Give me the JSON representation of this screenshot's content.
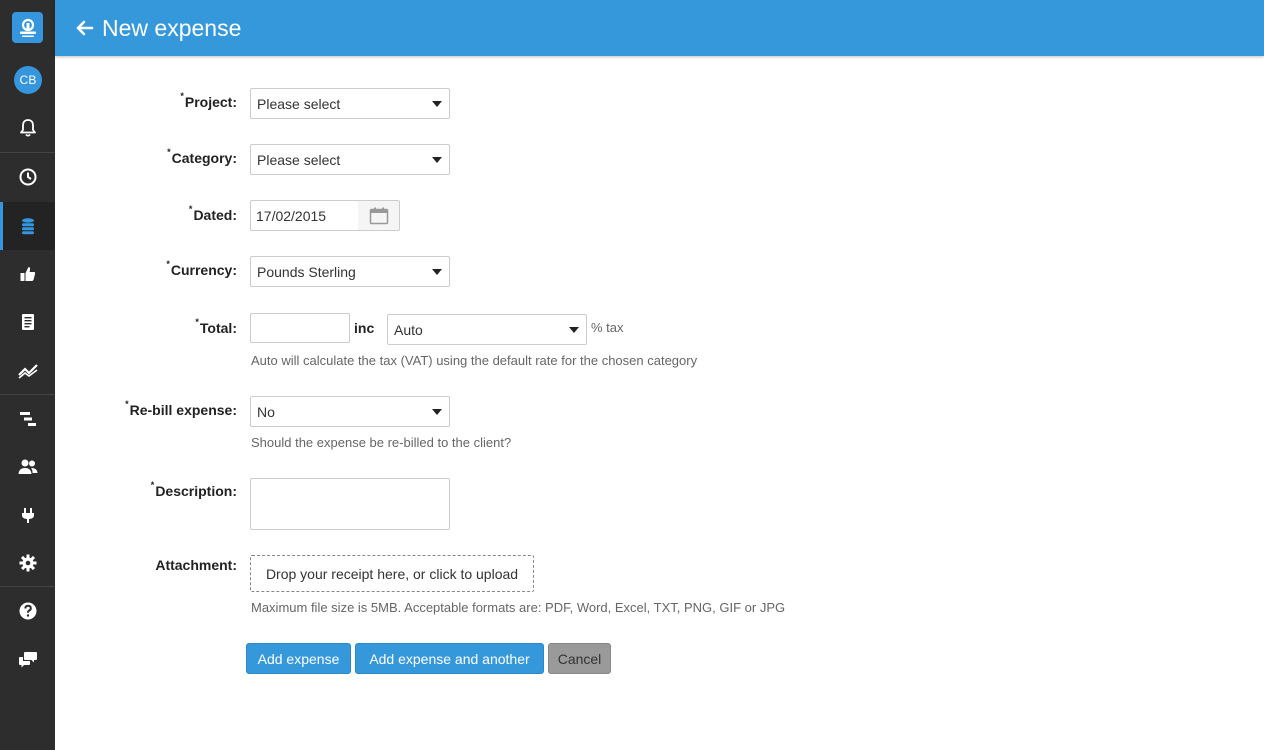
{
  "header": {
    "title": "New expense"
  },
  "sidebar": {
    "avatar_initials": "CB",
    "items": [
      {
        "name": "notifications",
        "icon": "bell-icon"
      },
      {
        "name": "time",
        "icon": "clock-icon"
      },
      {
        "name": "expenses",
        "icon": "coins-icon",
        "active": true
      },
      {
        "name": "approvals",
        "icon": "thumbs-up-icon"
      },
      {
        "name": "invoices",
        "icon": "document-icon"
      },
      {
        "name": "reports",
        "icon": "chart-line-icon"
      },
      {
        "name": "planning",
        "icon": "gantt-icon"
      },
      {
        "name": "people",
        "icon": "users-icon"
      },
      {
        "name": "integrations",
        "icon": "plug-icon"
      },
      {
        "name": "settings",
        "icon": "gear-icon"
      },
      {
        "name": "help",
        "icon": "question-icon"
      },
      {
        "name": "feedback",
        "icon": "chat-icon"
      }
    ]
  },
  "form": {
    "required_mark": "*",
    "project": {
      "label": "Project:",
      "value": "Please select"
    },
    "category": {
      "label": "Category:",
      "value": "Please select"
    },
    "dated": {
      "label": "Dated:",
      "value": "17/02/2015"
    },
    "currency": {
      "label": "Currency:",
      "value": "Pounds Sterling"
    },
    "total": {
      "label": "Total:",
      "value": "",
      "inc_label": "inc",
      "tax_value": "Auto",
      "tax_suffix": "% tax",
      "help": "Auto will calculate the tax (VAT) using the default rate for the chosen category"
    },
    "rebill": {
      "label": "Re-bill expense:",
      "value": "No",
      "help": "Should the expense be re-billed to the client?"
    },
    "description": {
      "label": "Description:",
      "value": ""
    },
    "attachment": {
      "label": "Attachment:",
      "dropzone": "Drop your receipt here, or click to upload",
      "help": "Maximum file size is 5MB. Acceptable formats are: PDF, Word, Excel, TXT, PNG, GIF or JPG"
    }
  },
  "buttons": {
    "add": "Add expense",
    "add_another": "Add expense and another",
    "cancel": "Cancel"
  },
  "colors": {
    "accent": "#3598db",
    "sidebar": "#2d2d2d",
    "cancel": "#9a9a9a"
  }
}
